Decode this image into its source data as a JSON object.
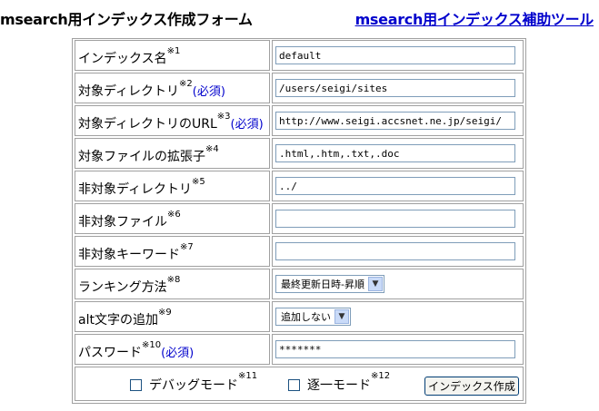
{
  "header": {
    "title": "msearch用インデックス作成フォーム",
    "tool_link": "msearch用インデックス補助ツール"
  },
  "form": {
    "rows": [
      {
        "label": "インデックス名",
        "note": "※1",
        "required": "",
        "value": "default"
      },
      {
        "label": "対象ディレクトリ",
        "note": "※2",
        "required": "(必須)",
        "value": "/users/seigi/sites"
      },
      {
        "label": "対象ディレクトリのURL",
        "note": "※3",
        "required": "(必須)",
        "value": "http://www.seigi.accsnet.ne.jp/seigi/"
      },
      {
        "label": "対象ファイルの拡張子",
        "note": "※4",
        "required": "",
        "value": ".html,.htm,.txt,.doc"
      },
      {
        "label": "非対象ディレクトリ",
        "note": "※5",
        "required": "",
        "value": "../"
      },
      {
        "label": "非対象ファイル",
        "note": "※6",
        "required": "",
        "value": ""
      },
      {
        "label": "非対象キーワード",
        "note": "※7",
        "required": "",
        "value": ""
      },
      {
        "label": "ランキング方法",
        "note": "※8",
        "required": "",
        "value": "最終更新日時-昇順"
      },
      {
        "label": "alt文字の追加",
        "note": "※9",
        "required": "",
        "value": "追加しない"
      },
      {
        "label": "パスワード",
        "note": "※10",
        "required": "(必須)",
        "value": "*******"
      }
    ],
    "debug_mode": {
      "label": "デバッグモード",
      "note": "※11",
      "checked": false
    },
    "sequential_mode": {
      "label": "逐一モード",
      "note": "※12",
      "checked": false
    },
    "submit_label": "インデックス作成"
  },
  "colors": {
    "link": "#0000cc",
    "border": "#a0a0a0",
    "input_border": "#7f9db9"
  }
}
